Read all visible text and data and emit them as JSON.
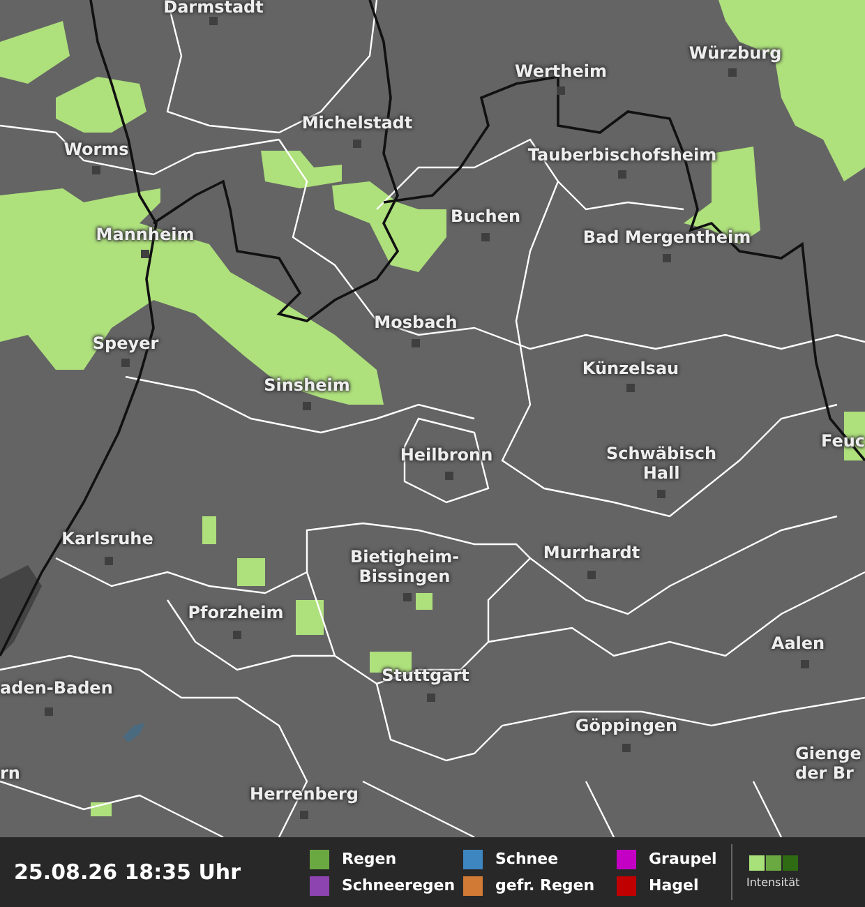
{
  "map": {
    "cities": [
      {
        "name": "Darmstadt"
      },
      {
        "name": "Würzburg"
      },
      {
        "name": "Wertheim"
      },
      {
        "name": "Michelstadt"
      },
      {
        "name": "Worms"
      },
      {
        "name": "Tauberbischofsheim"
      },
      {
        "name": "Buchen"
      },
      {
        "name": "Mannheim"
      },
      {
        "name": "Bad Mergentheim"
      },
      {
        "name": "Mosbach"
      },
      {
        "name": "Speyer"
      },
      {
        "name": "Künzelsau"
      },
      {
        "name": "Sinsheim"
      },
      {
        "name": "Feuc"
      },
      {
        "name": "Heilbronn"
      },
      {
        "name": "Schwäbisch Hall"
      },
      {
        "name": "Karlsruhe"
      },
      {
        "name": "Murrhardt"
      },
      {
        "name": "Bietigheim-Bissingen"
      },
      {
        "name": "Pforzheim"
      },
      {
        "name": "Aalen"
      },
      {
        "name": "Stuttgart"
      },
      {
        "name": "aden-Baden"
      },
      {
        "name": "Göppingen"
      },
      {
        "name": "rn"
      },
      {
        "name": "Gienge der Br"
      },
      {
        "name": "Herrenberg"
      }
    ]
  },
  "status_bar": {
    "timestamp": "25.08.26 18:35 Uhr",
    "legend": [
      {
        "label": "Regen",
        "color": "#6aa842"
      },
      {
        "label": "Schneeregen",
        "color": "#8e44b0"
      },
      {
        "label": "Schnee",
        "color": "#3d86c0"
      },
      {
        "label": "gefr. Regen",
        "color": "#d07a35"
      },
      {
        "label": "Graupel",
        "color": "#c400c4"
      },
      {
        "label": "Hagel",
        "color": "#c00000"
      }
    ],
    "intensity": {
      "label": "Intensität",
      "steps": [
        {
          "color": "#a8e07a"
        },
        {
          "color": "#6aa842"
        },
        {
          "color": "#2e6b12"
        }
      ]
    }
  }
}
